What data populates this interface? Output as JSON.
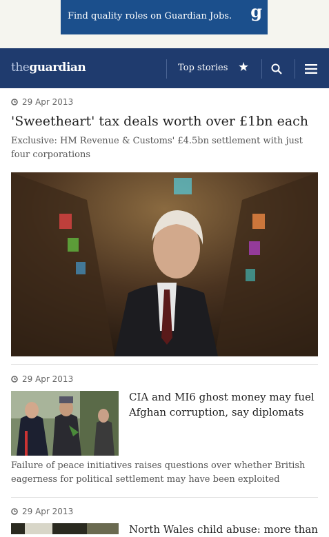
{
  "ad": {
    "text": "Find quality roles on Guardian Jobs.",
    "logo": "g"
  },
  "header": {
    "logo_the": "the",
    "logo_guardian": "guardian",
    "top_stories": "Top stories",
    "icons": [
      "star-icon",
      "search-icon",
      "menu-icon"
    ],
    "bg_color": "#1f3b6e"
  },
  "articles": [
    {
      "date": "29 Apr 2013",
      "headline": "'Sweetheart' tax deals worth over £1bn each",
      "standfirst": "Exclusive: HM Revenue & Customs' £4.5bn settlement with just four corporations"
    },
    {
      "date": "29 Apr 2013",
      "headline": "CIA and MI6 ghost money may fuel Afghan corruption, say diplomats",
      "standfirst": "Failure of peace initiatives raises questions over whether British eagerness for political settlement may have been exploited"
    },
    {
      "date": "29 Apr 2013",
      "headline": "North Wales child abuse: more than"
    }
  ]
}
